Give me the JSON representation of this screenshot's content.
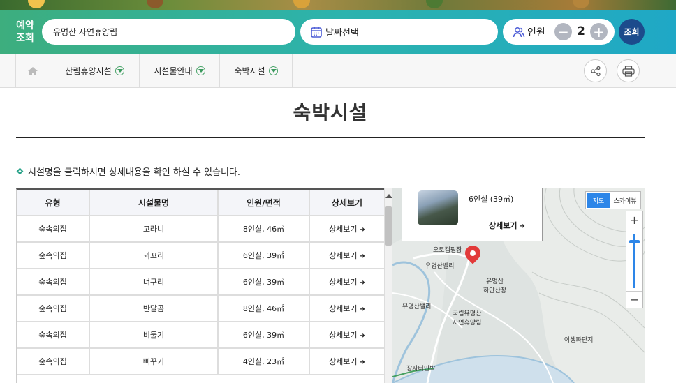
{
  "reservation": {
    "label": "예약\n조회",
    "place": "유명산 자연휴양림",
    "date_label": "날짜선택",
    "people_label": "인원",
    "people_count": "2",
    "minus": "−",
    "plus": "+",
    "search_label": "조회"
  },
  "nav": {
    "items": [
      {
        "label": "산림휴양시설"
      },
      {
        "label": "시설물안내"
      },
      {
        "label": "숙박시설"
      }
    ]
  },
  "page": {
    "title": "숙박시설",
    "hint": "시설명을 클릭하시면 상세내용을 확인 하실 수 있습니다."
  },
  "table": {
    "headers": [
      "유형",
      "시설물명",
      "인원/면적",
      "상세보기"
    ],
    "rows": [
      {
        "type": "숲속의집",
        "name": "고라니",
        "capacity": "8인실, 46㎡",
        "detail": "상세보기"
      },
      {
        "type": "숲속의집",
        "name": "꾀꼬리",
        "capacity": "6인실, 39㎡",
        "detail": "상세보기"
      },
      {
        "type": "숲속의집",
        "name": "너구리",
        "capacity": "6인실, 39㎡",
        "detail": "상세보기"
      },
      {
        "type": "숲속의집",
        "name": "반달곰",
        "capacity": "8인실, 46㎡",
        "detail": "상세보기"
      },
      {
        "type": "숲속의집",
        "name": "비둘기",
        "capacity": "6인실, 39㎡",
        "detail": "상세보기"
      },
      {
        "type": "숲속의집",
        "name": "뻐꾸기",
        "capacity": "4인실, 23㎡",
        "detail": "상세보기"
      }
    ]
  },
  "map": {
    "popup": {
      "capacity": "6인실 (39㎡)",
      "detail": "상세보기"
    },
    "type_map": "지도",
    "type_sky": "스카이뷰",
    "zoom_in": "+",
    "zoom_out": "−",
    "labels": {
      "camp": "오토캠핑장",
      "valley1": "유명산밸리",
      "lodge": "유명산\n하얀산장",
      "valley2": "유명산밸리",
      "forest": "국립유명산\n자연휴양림",
      "farm": "야생화단지",
      "market": "장자터민박"
    },
    "colors": {
      "marker": "#e23a3a",
      "active_tab": "#2d86e8"
    }
  }
}
